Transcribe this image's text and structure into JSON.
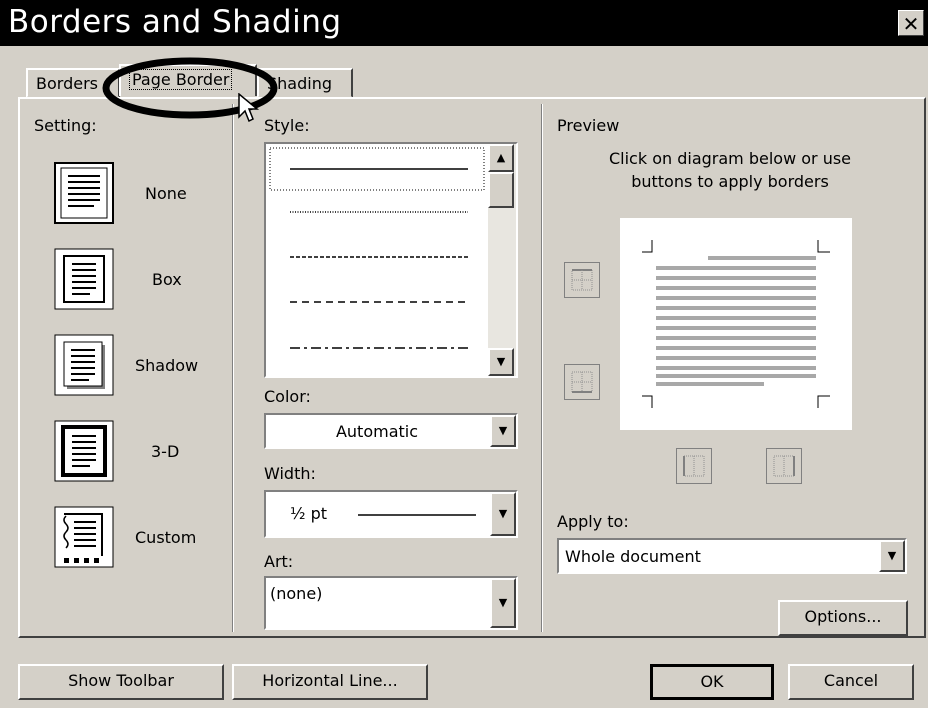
{
  "window": {
    "title": "Borders and Shading",
    "close_glyph": "✕"
  },
  "tabs": [
    {
      "label": "Borders"
    },
    {
      "label": "Page Border"
    },
    {
      "label": "Shading"
    }
  ],
  "setting": {
    "header": "Setting:",
    "items": [
      {
        "label": "None"
      },
      {
        "label": "Box"
      },
      {
        "label": "Shadow"
      },
      {
        "label": "3-D"
      },
      {
        "label": "Custom"
      }
    ]
  },
  "style": {
    "header": "Style:"
  },
  "color": {
    "label": "Color:",
    "value": "Automatic"
  },
  "width": {
    "label": "Width:",
    "value": "½ pt"
  },
  "art": {
    "label": "Art:",
    "value": "(none)"
  },
  "preview": {
    "header": "Preview",
    "instruction_line1": "Click on diagram below or use",
    "instruction_line2": "buttons to apply borders"
  },
  "apply_to": {
    "label": "Apply to:",
    "value": "Whole document"
  },
  "buttons": {
    "options": "Options...",
    "show_toolbar": "Show Toolbar",
    "horizontal_line": "Horizontal Line...",
    "ok": "OK",
    "cancel": "Cancel"
  },
  "colors": {
    "dialog_bg": "#d4d0c8",
    "titlebar_bg": "#000000",
    "highlight_circle": "#000000"
  }
}
